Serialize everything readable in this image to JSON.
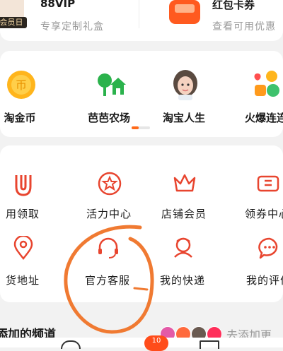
{
  "top_card": {
    "vip": {
      "badge": "会员日",
      "title": "88VIP",
      "subtitle": "专享定制礼盒"
    },
    "red_packet": {
      "title": "红包卡券",
      "subtitle": "查看可用优惠"
    }
  },
  "tools": [
    {
      "label": "淘金币",
      "icon": "coin-icon"
    },
    {
      "label": "芭芭农场",
      "icon": "farm-icon"
    },
    {
      "label": "淘宝人生",
      "icon": "avatar-icon"
    },
    {
      "label": "火爆连连",
      "icon": "game-icon"
    }
  ],
  "services_row1": [
    {
      "label": "用领取",
      "icon": "u-icon"
    },
    {
      "label": "活力中心",
      "icon": "star-circle-icon"
    },
    {
      "label": "店铺会员",
      "icon": "crown-icon"
    },
    {
      "label": "领券中心",
      "icon": "coupon-icon"
    }
  ],
  "services_row2": [
    {
      "label": "货地址",
      "icon": "location-icon"
    },
    {
      "label": "官方客服",
      "icon": "headset-icon"
    },
    {
      "label": "我的快递",
      "icon": "courier-icon"
    },
    {
      "label": "我的评价",
      "icon": "comment-icon"
    }
  ],
  "bottom": {
    "section_title": "添加的频道",
    "more_link": "去添加更",
    "message_badge": "10"
  },
  "colors": {
    "accent": "#ff5a1f",
    "icon_red": "#e8452f",
    "annotation": "#f07a32",
    "tool_farm": "#2bb24c"
  }
}
